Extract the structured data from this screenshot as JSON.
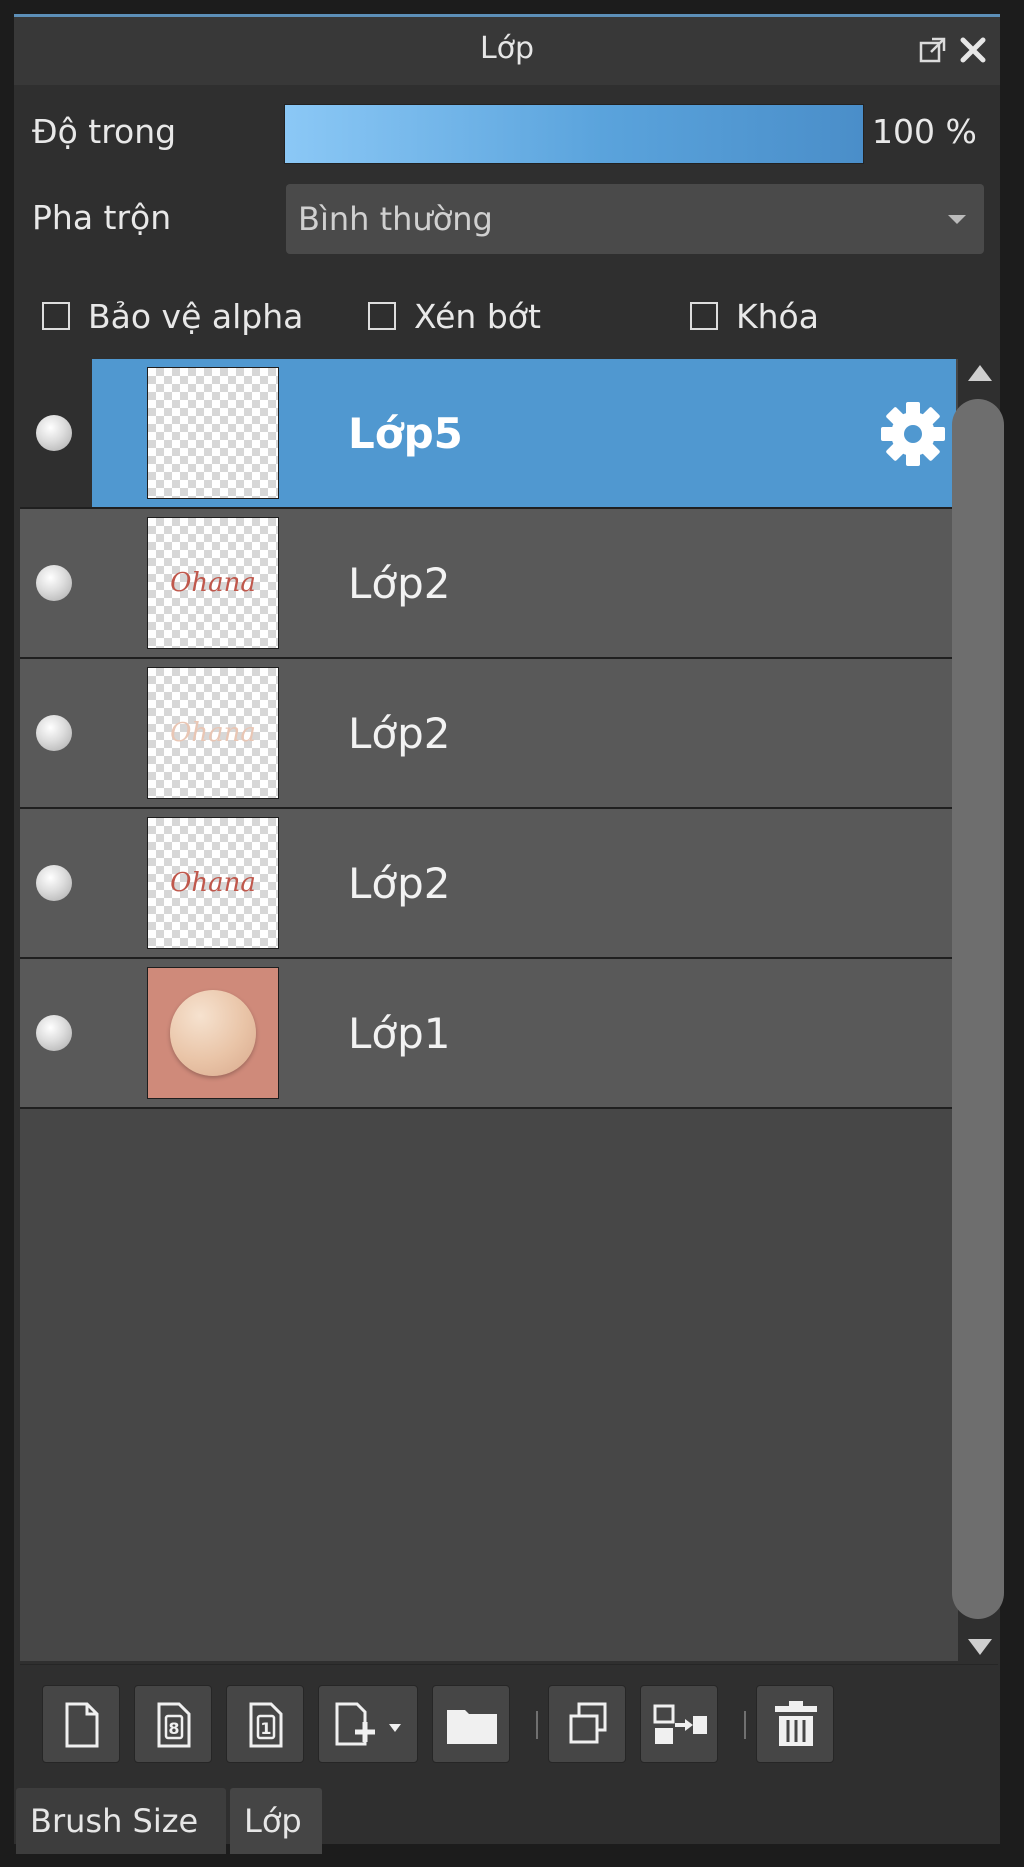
{
  "panel": {
    "title": "Lớp",
    "opacity_label": "Độ trong",
    "opacity_value": "100 %",
    "opacity_percent": 100,
    "blend_label": "Pha trộn",
    "blend_value": "Bình thường",
    "checkboxes": [
      {
        "label": "Bảo vệ alpha",
        "checked": false
      },
      {
        "label": "Xén bớt",
        "checked": false
      },
      {
        "label": "Khóa",
        "checked": false
      }
    ]
  },
  "layers": [
    {
      "name": "Lớp5",
      "selected": true,
      "thumb_text": ""
    },
    {
      "name": "Lớp2",
      "selected": false,
      "thumb_text": "Ohana"
    },
    {
      "name": "Lớp2",
      "selected": false,
      "thumb_text": "Ohana"
    },
    {
      "name": "Lớp2",
      "selected": false,
      "thumb_text": "Ohana"
    },
    {
      "name": "Lớp1",
      "selected": false,
      "thumb_text": ""
    }
  ],
  "toolbar": {
    "icons": [
      "new-layer-icon",
      "new-8bit-layer-icon",
      "new-1bit-layer-icon",
      "add-layer-dropdown-icon",
      "folder-icon",
      "duplicate-layer-icon",
      "merge-down-icon",
      "delete-layer-icon"
    ]
  },
  "tabs": [
    {
      "label": "Brush Size",
      "active": false
    },
    {
      "label": "Lớp",
      "active": true
    }
  ],
  "colors": {
    "selected_row": "#5098d0",
    "opacity_fill": "#5aa3dc",
    "panel_bg": "#2f2f2f"
  }
}
